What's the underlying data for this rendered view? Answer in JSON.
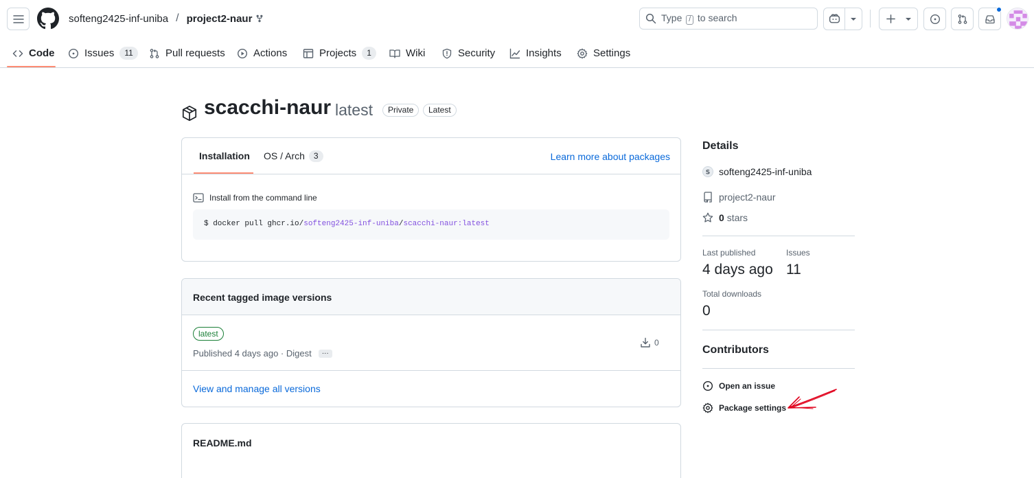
{
  "header": {
    "owner": "softeng2425-inf-uniba",
    "separator": "/",
    "repo": "project2-naur",
    "search_prefix": "Type",
    "search_key": "/",
    "search_suffix": "to search"
  },
  "repo_nav": [
    {
      "label": "Code",
      "icon": "code-icon",
      "selected": true
    },
    {
      "label": "Issues",
      "count": "11",
      "icon": "issue-opened-icon"
    },
    {
      "label": "Pull requests",
      "icon": "git-pull-request-icon"
    },
    {
      "label": "Actions",
      "icon": "play-icon"
    },
    {
      "label": "Projects",
      "count": "1",
      "icon": "table-icon"
    },
    {
      "label": "Wiki",
      "icon": "book-icon"
    },
    {
      "label": "Security",
      "icon": "shield-icon"
    },
    {
      "label": "Insights",
      "icon": "graph-icon"
    },
    {
      "label": "Settings",
      "icon": "gear-icon"
    }
  ],
  "package": {
    "name": "scacchi-naur",
    "tag": "latest",
    "badges": [
      "Private",
      "Latest"
    ]
  },
  "installation": {
    "tabs": [
      {
        "label": "Installation",
        "selected": true
      },
      {
        "label": "OS / Arch",
        "count": "3"
      }
    ],
    "learn_more": "Learn more about packages",
    "label": "Install from the command line",
    "command_prefix": "$ docker pull ghcr.io/",
    "command_owner": "softeng2425-inf-uniba",
    "command_slash": "/",
    "command_image": "scacchi-naur:latest"
  },
  "versions": {
    "heading": "Recent tagged image versions",
    "items": [
      {
        "tag": "latest",
        "published": "Published 4 days ago · Digest",
        "downloads": "0"
      }
    ],
    "view_all": "View and manage all versions"
  },
  "readme": {
    "heading": "README.md"
  },
  "sidebar": {
    "details_heading": "Details",
    "owner": "softeng2425-inf-uniba",
    "repo": "project2-naur",
    "stars_count": "0",
    "stars_label": "stars",
    "last_published_label": "Last published",
    "last_published_value": "4 days ago",
    "issues_label": "Issues",
    "issues_value": "11",
    "downloads_label": "Total downloads",
    "downloads_value": "0",
    "contributors_heading": "Contributors",
    "open_issue": "Open an issue",
    "package_settings": "Package settings"
  },
  "colors": {
    "accent_underline": "#fd8c73",
    "link": "#0969da",
    "success": "#1a7f37",
    "annotation": "#e0001b"
  }
}
